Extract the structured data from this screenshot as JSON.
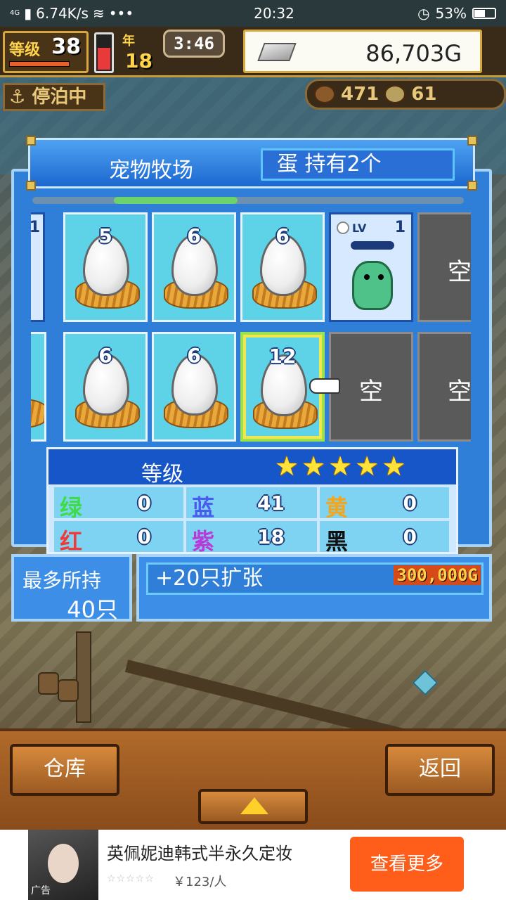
{
  "status_bar": {
    "network": "4G",
    "speed": "6.74K/s",
    "dots": "•••",
    "time": "20:32",
    "battery": "53%",
    "battery_level": 0.53
  },
  "hud": {
    "level_label": "等级",
    "level": "38",
    "year_label": "年",
    "day": "18",
    "clock": "3:46",
    "gold": "86,703G",
    "dock_status": "停泊中",
    "resource_a": "471",
    "resource_b": "61"
  },
  "panel": {
    "title": "宠物牧场",
    "egg_count": "蛋 持有2个",
    "grid_row1": [
      {
        "type": "pet-partial",
        "level": "1"
      },
      {
        "type": "egg",
        "number": "5"
      },
      {
        "type": "egg",
        "number": "6"
      },
      {
        "type": "egg",
        "number": "6"
      },
      {
        "type": "pet",
        "level_prefix": "LV",
        "level": "1"
      },
      {
        "type": "empty",
        "label": "空"
      }
    ],
    "grid_row2": [
      {
        "type": "egg-partial"
      },
      {
        "type": "egg",
        "number": "6"
      },
      {
        "type": "egg",
        "number": "6"
      },
      {
        "type": "egg",
        "number": "12",
        "selected": true
      },
      {
        "type": "empty",
        "label": "空"
      },
      {
        "type": "empty",
        "label": "空"
      }
    ]
  },
  "stats": {
    "title": "等级",
    "stars": 5,
    "star_glyph": "★",
    "rows": [
      [
        {
          "color_name": "绿",
          "value": "0",
          "color": "#3fdc4a"
        },
        {
          "color_name": "蓝",
          "value": "41",
          "color": "#4a5cf0"
        },
        {
          "color_name": "黄",
          "value": "0",
          "color": "#f5a51a"
        }
      ],
      [
        {
          "color_name": "红",
          "value": "0",
          "color": "#f03a3a"
        },
        {
          "color_name": "紫",
          "value": "18",
          "color": "#b83ad8"
        },
        {
          "color_name": "黑",
          "value": "0",
          "color": "#111111"
        }
      ]
    ]
  },
  "capacity": {
    "label": "最多所持",
    "value": "40只"
  },
  "expand": {
    "label": "+20只扩张",
    "cost": "300,000G"
  },
  "bottom": {
    "warehouse": "仓库",
    "back": "返回"
  },
  "ad": {
    "tag": "广告",
    "headline": "英佩妮迪韩式半永久定妆",
    "rating": "☆☆☆☆☆",
    "price": "￥123/人",
    "cta": "查看更多"
  }
}
